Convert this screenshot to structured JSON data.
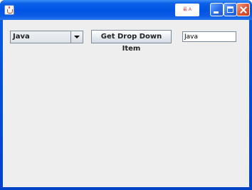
{
  "window": {
    "app_icon": "java-cup-icon",
    "ime_indicator": "最 A",
    "buttons": {
      "minimize": "minimize-icon",
      "maximize": "maximize-icon",
      "close": "close-icon"
    }
  },
  "form": {
    "combo_selected": "Java",
    "combo_arrow_icon": "chevron-down-icon",
    "button_label": "Get Drop Down Item",
    "text_field_value": "Java"
  },
  "colors": {
    "titlebar": "#0054e3",
    "client_bg": "#eeeeee",
    "close_button": "#e0583a"
  }
}
